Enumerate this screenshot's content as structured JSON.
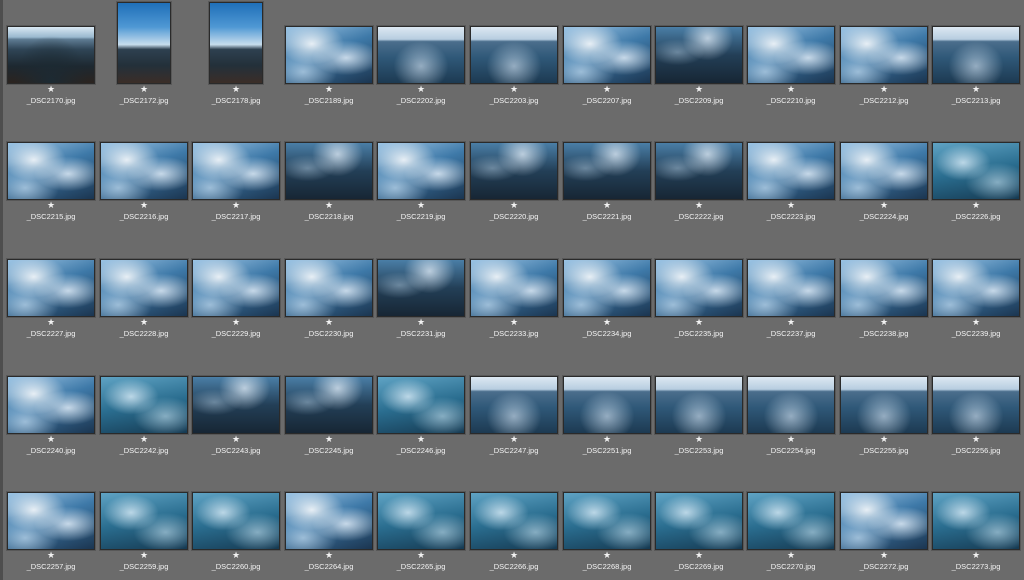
{
  "star_glyph": "★",
  "rows": [
    [
      {
        "name": "_DSC2170.jpg",
        "style": "lake",
        "portrait": false
      },
      {
        "name": "_DSC2172.jpg",
        "style": "sky",
        "portrait": true
      },
      {
        "name": "_DSC2178.jpg",
        "style": "sky",
        "portrait": true
      },
      {
        "name": "_DSC2189.jpg",
        "style": "foam",
        "portrait": false
      },
      {
        "name": "_DSC2202.jpg",
        "style": "horizon",
        "portrait": false
      },
      {
        "name": "_DSC2203.jpg",
        "style": "horizon",
        "portrait": false
      },
      {
        "name": "_DSC2207.jpg",
        "style": "foam",
        "portrait": false
      },
      {
        "name": "_DSC2209.jpg",
        "style": "dark",
        "portrait": false
      },
      {
        "name": "_DSC2210.jpg",
        "style": "foam",
        "portrait": false
      },
      {
        "name": "_DSC2212.jpg",
        "style": "foam",
        "portrait": false
      },
      {
        "name": "_DSC2213.jpg",
        "style": "horizon",
        "portrait": false
      }
    ],
    [
      {
        "name": "_DSC2215.jpg",
        "style": "foam",
        "portrait": false
      },
      {
        "name": "_DSC2216.jpg",
        "style": "foam",
        "portrait": false
      },
      {
        "name": "_DSC2217.jpg",
        "style": "foam",
        "portrait": false
      },
      {
        "name": "_DSC2218.jpg",
        "style": "dark",
        "portrait": false
      },
      {
        "name": "_DSC2219.jpg",
        "style": "foam",
        "portrait": false
      },
      {
        "name": "_DSC2220.jpg",
        "style": "dark",
        "portrait": false
      },
      {
        "name": "_DSC2221.jpg",
        "style": "dark",
        "portrait": false
      },
      {
        "name": "_DSC2222.jpg",
        "style": "dark",
        "portrait": false
      },
      {
        "name": "_DSC2223.jpg",
        "style": "foam",
        "portrait": false
      },
      {
        "name": "_DSC2224.jpg",
        "style": "foam",
        "portrait": false
      },
      {
        "name": "_DSC2226.jpg",
        "style": "teal",
        "portrait": false
      }
    ],
    [
      {
        "name": "_DSC2227.jpg",
        "style": "foam",
        "portrait": false
      },
      {
        "name": "_DSC2228.jpg",
        "style": "foam",
        "portrait": false
      },
      {
        "name": "_DSC2229.jpg",
        "style": "foam",
        "portrait": false
      },
      {
        "name": "_DSC2230.jpg",
        "style": "foam",
        "portrait": false
      },
      {
        "name": "_DSC2231.jpg",
        "style": "dark",
        "portrait": false
      },
      {
        "name": "_DSC2233.jpg",
        "style": "foam",
        "portrait": false
      },
      {
        "name": "_DSC2234.jpg",
        "style": "foam",
        "portrait": false
      },
      {
        "name": "_DSC2235.jpg",
        "style": "foam",
        "portrait": false
      },
      {
        "name": "_DSC2237.jpg",
        "style": "foam",
        "portrait": false
      },
      {
        "name": "_DSC2238.jpg",
        "style": "foam",
        "portrait": false
      },
      {
        "name": "_DSC2239.jpg",
        "style": "foam",
        "portrait": false
      }
    ],
    [
      {
        "name": "_DSC2240.jpg",
        "style": "foam",
        "portrait": false
      },
      {
        "name": "_DSC2242.jpg",
        "style": "teal",
        "portrait": false
      },
      {
        "name": "_DSC2243.jpg",
        "style": "dark",
        "portrait": false
      },
      {
        "name": "_DSC2245.jpg",
        "style": "dark",
        "portrait": false
      },
      {
        "name": "_DSC2246.jpg",
        "style": "teal",
        "portrait": false
      },
      {
        "name": "_DSC2247.jpg",
        "style": "horizon",
        "portrait": false
      },
      {
        "name": "_DSC2251.jpg",
        "style": "horizon",
        "portrait": false
      },
      {
        "name": "_DSC2253.jpg",
        "style": "horizon",
        "portrait": false
      },
      {
        "name": "_DSC2254.jpg",
        "style": "horizon",
        "portrait": false
      },
      {
        "name": "_DSC2255.jpg",
        "style": "horizon",
        "portrait": false
      },
      {
        "name": "_DSC2256.jpg",
        "style": "horizon",
        "portrait": false
      }
    ],
    [
      {
        "name": "_DSC2257.jpg",
        "style": "foam",
        "portrait": false
      },
      {
        "name": "_DSC2259.jpg",
        "style": "teal",
        "portrait": false
      },
      {
        "name": "_DSC2260.jpg",
        "style": "teal",
        "portrait": false
      },
      {
        "name": "_DSC2264.jpg",
        "style": "foam",
        "portrait": false
      },
      {
        "name": "_DSC2265.jpg",
        "style": "teal",
        "portrait": false
      },
      {
        "name": "_DSC2266.jpg",
        "style": "teal",
        "portrait": false
      },
      {
        "name": "_DSC2268.jpg",
        "style": "teal",
        "portrait": false
      },
      {
        "name": "_DSC2269.jpg",
        "style": "teal",
        "portrait": false
      },
      {
        "name": "_DSC2270.jpg",
        "style": "teal",
        "portrait": false
      },
      {
        "name": "_DSC2272.jpg",
        "style": "foam",
        "portrait": false
      },
      {
        "name": "_DSC2273.jpg",
        "style": "teal",
        "portrait": false
      }
    ]
  ]
}
